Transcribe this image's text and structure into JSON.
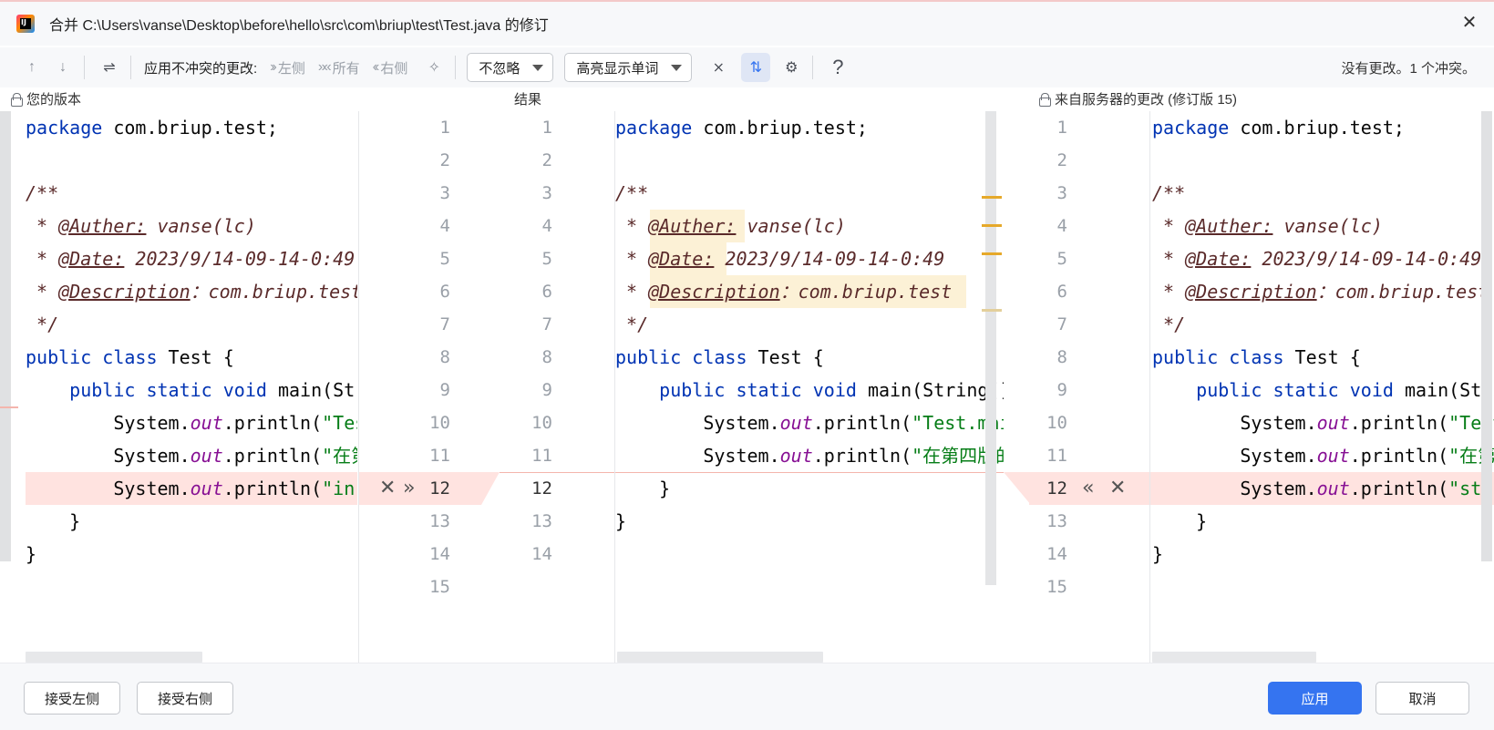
{
  "titlebar": {
    "title": "合并 C:\\Users\\vanse\\Desktop\\before\\hello\\src\\com\\briup\\test\\Test.java 的修订",
    "close_icon": "close-icon"
  },
  "toolbar": {
    "apply_non_conflicting_label": "应用不冲突的更改:",
    "left_label": "左侧",
    "all_label": "所有",
    "right_label": "右侧",
    "ignore_dropdown": "不忽略",
    "highlight_dropdown": "高亮显示单词",
    "help": "?",
    "status": "没有更改。1 个冲突。"
  },
  "panes": {
    "left_title": "您的版本",
    "center_title": "结果",
    "right_title": "来自服务器的更改 (修订版 15)"
  },
  "line_numbers": {
    "left": [
      "1",
      "2",
      "3",
      "4",
      "5",
      "6",
      "7",
      "8",
      "9",
      "10",
      "11",
      "12",
      "13",
      "14",
      "15"
    ],
    "center": [
      "1",
      "2",
      "3",
      "4",
      "5",
      "6",
      "7",
      "8",
      "9",
      "10",
      "11",
      "12",
      "13",
      "14"
    ],
    "right": [
      "1",
      "2",
      "3",
      "4",
      "5",
      "6",
      "7",
      "8",
      "9",
      "10",
      "11",
      "12",
      "13",
      "14",
      "15"
    ]
  },
  "code": {
    "package_kw": "package",
    "package_name": " com.briup.test;",
    "doc_open": "/**",
    "star": " * ",
    "author_tag": "@Auther:",
    "author_val": " vanse(lc)",
    "date_tag": "@Date:",
    "date_val": " 2023/9/14-09-14-0:49",
    "desc_tag": "@Description",
    "desc_val": "：com.briup.test",
    "doc_close": " */",
    "class_kw": "public class",
    "class_name": " Test {",
    "main_kw": "    public static void",
    "main_name": " main(String[] args) {",
    "sys": "        System.",
    "out": "out",
    "println": ".println(",
    "left_l10_str": "\"Test.main\");",
    "left_l11_str": "\"在第四版的代码\");",
    "left_l12_str": "\"in the left version\");",
    "right_l12_str": "\"str from server\");",
    "close_brace_inner": "    }",
    "close_brace": "}"
  },
  "footer": {
    "accept_left": "接受左侧",
    "accept_right": "接受右侧",
    "apply": "应用",
    "cancel": "取消"
  }
}
